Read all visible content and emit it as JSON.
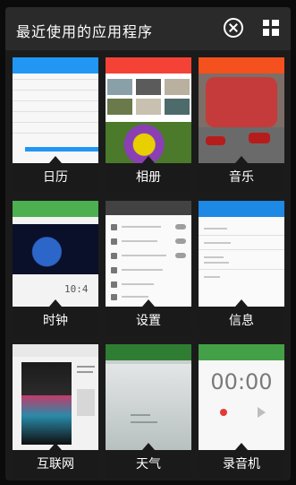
{
  "header": {
    "title": "最近使用的应用程序",
    "close_icon": "close-circle-icon",
    "grid_icon": "grid-icon"
  },
  "apps": [
    {
      "label": "日历",
      "accent": "#2196f3"
    },
    {
      "label": "相册",
      "accent": "#f44336"
    },
    {
      "label": "音乐",
      "accent": "#f4511e"
    },
    {
      "label": "时钟",
      "accent": "#4caf50",
      "thumb_text": "10:4"
    },
    {
      "label": "设置",
      "accent": "#424242"
    },
    {
      "label": "信息",
      "accent": "#1e88e5"
    },
    {
      "label": "互联网",
      "accent": "#eeeeee"
    },
    {
      "label": "天气",
      "accent": "#2e7d32"
    },
    {
      "label": "录音机",
      "accent": "#43a047",
      "thumb_text": "00:00"
    }
  ]
}
